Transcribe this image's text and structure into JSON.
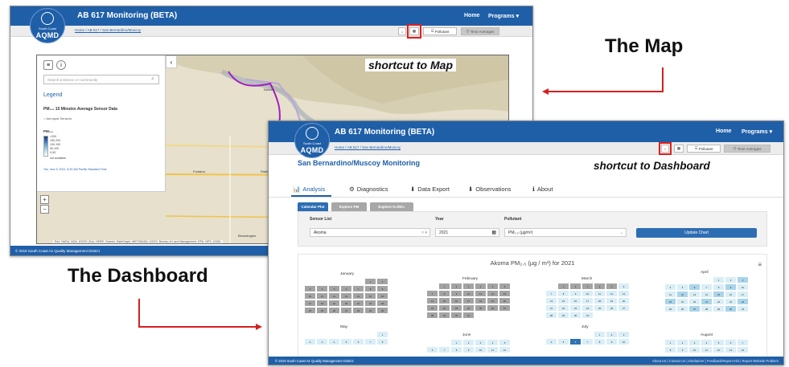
{
  "header": {
    "title": "AB 617 Monitoring (BETA)",
    "logo_line1": "South Coast",
    "logo_line2": "AQMD",
    "nav_home": "Home",
    "nav_programs": "Programs ▾"
  },
  "breadcrumb": {
    "items": [
      "Home",
      "AB 617",
      "San Bernardino/Muscoy"
    ],
    "separator": "/"
  },
  "toolbar": {
    "pollutant_label": "Pollutant",
    "time_averages_label": "Time Averages"
  },
  "map_panel": {
    "search_placeholder": "Search a Device or Community",
    "legend_title": "Legend",
    "subtitle": "PM₂.₅ 10 Minutes Average Sensor Data",
    "radio_label": "Aeroqual Sensors",
    "pm_label": "PM₂.₅",
    "scale": [
      ">200",
      "150-200",
      "100-150",
      "50-100",
      "0-50",
      "not available"
    ],
    "timestamp": "Tue, Nov 9, 2021, 8:20 AM Pacific Standard Time",
    "places": [
      "Fontana",
      "Rialto",
      "Devore",
      "Bloomington"
    ],
    "attribution": "Esri, NASA, NGA, USGS | Esri, HERE, Garmin, SafeGraph, METI/NASA, USGS, Bureau of Land Management, EPA, NPS, USDA"
  },
  "footer": {
    "copyright": "© 2019 South Coast Air Quality Management District",
    "links": "About Us  |  Contact Us  |  Disclaimer  |  Feedback/Report Info  |  Report Website Problem"
  },
  "callouts": {
    "map_shortcut": "shortcut to Map",
    "dashboard_shortcut": "shortcut to Dashboard",
    "the_map": "The Map",
    "the_dashboard": "The Dashboard"
  },
  "dashboard": {
    "page_title": "San Bernardino/Muscoy Monitoring",
    "tabs": [
      {
        "icon": "📊",
        "label": "Analysis"
      },
      {
        "icon": "⚙",
        "label": "Diagnostics"
      },
      {
        "icon": "⬇",
        "label": "Data Export"
      },
      {
        "icon": "⬇",
        "label": "Observations"
      },
      {
        "icon": "ℹ",
        "label": "About"
      }
    ],
    "subtabs": [
      "Calendar Plot",
      "Explore PM",
      "Explore O₃/NO₂"
    ],
    "form": {
      "sensor_label": "Sensor List",
      "sensor_value": "Akoma",
      "sensor_clear": "× ▾",
      "year_label": "Year",
      "year_value": "2021",
      "pollutant_label": "Pollutant",
      "pollutant_value": "PM₂.₅ (µg/m³)",
      "update_label": "Update Chart"
    },
    "chart_title": "Akoma PM₂.₅ (µg / m³) for 2021",
    "months": [
      "January",
      "February",
      "March",
      "April",
      "May",
      "June",
      "July",
      "August"
    ]
  },
  "colors": {
    "brand_blue": "#1f5fa8",
    "highlight_red": "#e31e1e",
    "calendar_gray": "#a3a3a3",
    "calendar_light": "#d9eef6"
  }
}
